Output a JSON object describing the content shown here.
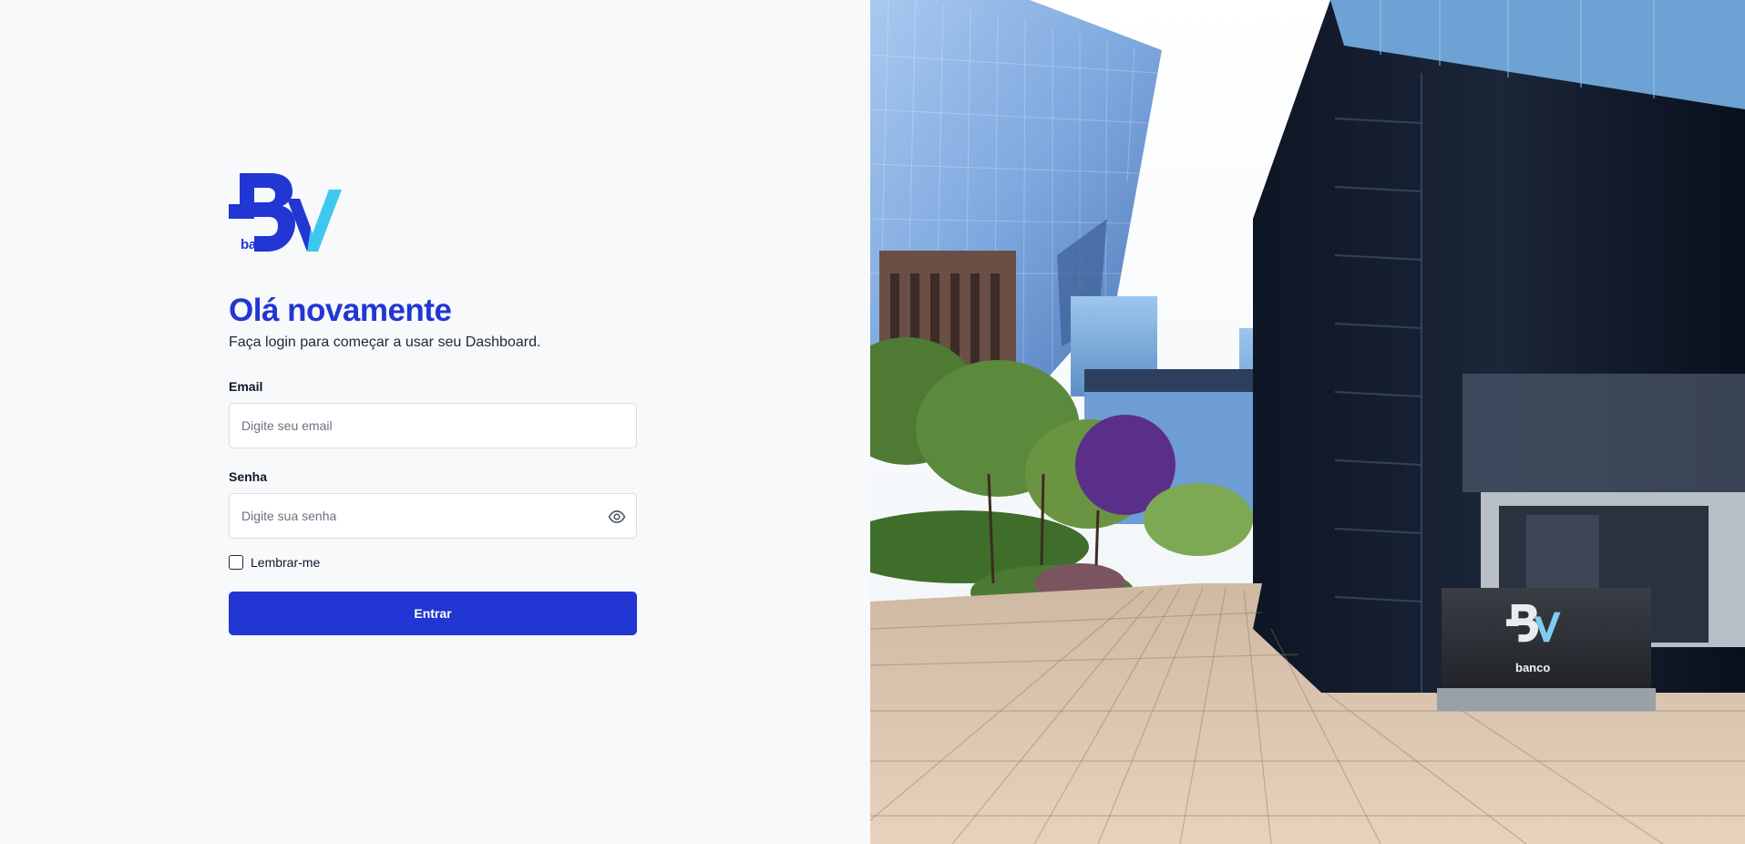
{
  "brand": {
    "logo_text": "banco",
    "primary_color": "#2236d4",
    "accent_color": "#3ec8ef"
  },
  "login": {
    "greeting": "Olá novamente",
    "subtitle": "Faça login para começar a usar seu Dashboard.",
    "email_label": "Email",
    "email_placeholder": "Digite seu email",
    "password_label": "Senha",
    "password_placeholder": "Digite sua senha",
    "remember_label": "Lembrar-me",
    "submit_label": "Entrar"
  },
  "photo": {
    "sign_text": "banco"
  }
}
